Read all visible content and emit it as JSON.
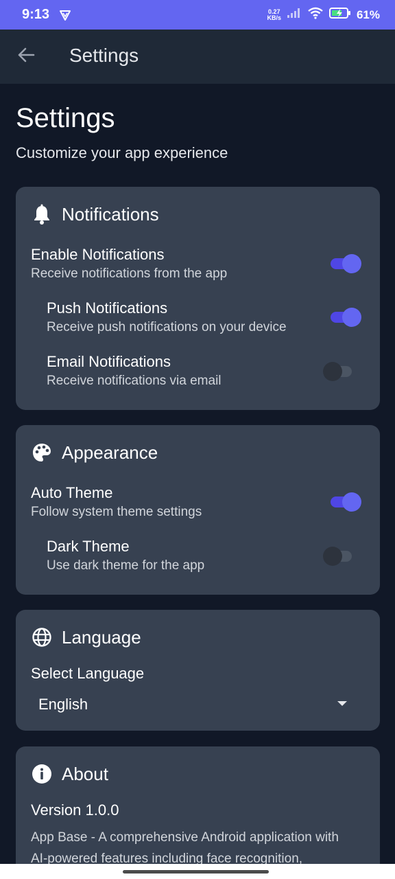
{
  "status_bar": {
    "time": "9:13",
    "net_speed_value": "0.27",
    "net_speed_unit": "KB/s",
    "battery_percent": "61%"
  },
  "app_bar": {
    "title": "Settings",
    "back_icon": "arrow-left-icon"
  },
  "page": {
    "title": "Settings",
    "subtitle": "Customize your app experience"
  },
  "notifications": {
    "icon": "bell-icon",
    "title": "Notifications",
    "items": [
      {
        "label": "Enable Notifications",
        "description": "Receive notifications from the app",
        "enabled": true
      },
      {
        "label": "Push Notifications",
        "description": "Receive push notifications on your device",
        "enabled": true
      },
      {
        "label": "Email Notifications",
        "description": "Receive notifications via email",
        "enabled": false
      }
    ]
  },
  "appearance": {
    "icon": "palette-icon",
    "title": "Appearance",
    "items": [
      {
        "label": "Auto Theme",
        "description": "Follow system theme settings",
        "enabled": true
      },
      {
        "label": "Dark Theme",
        "description": "Use dark theme for the app",
        "enabled": false
      }
    ]
  },
  "language": {
    "icon": "globe-icon",
    "title": "Language",
    "select_label": "Select Language",
    "selected": "English"
  },
  "about": {
    "icon": "info-icon",
    "title": "About",
    "version": "Version 1.0.0",
    "description": "App Base - A comprehensive Android application with AI-powered features including face recognition,"
  },
  "colors": {
    "accent": "#6366f1",
    "background": "#111827",
    "card": "#374151",
    "app_bar": "#1f2937"
  }
}
